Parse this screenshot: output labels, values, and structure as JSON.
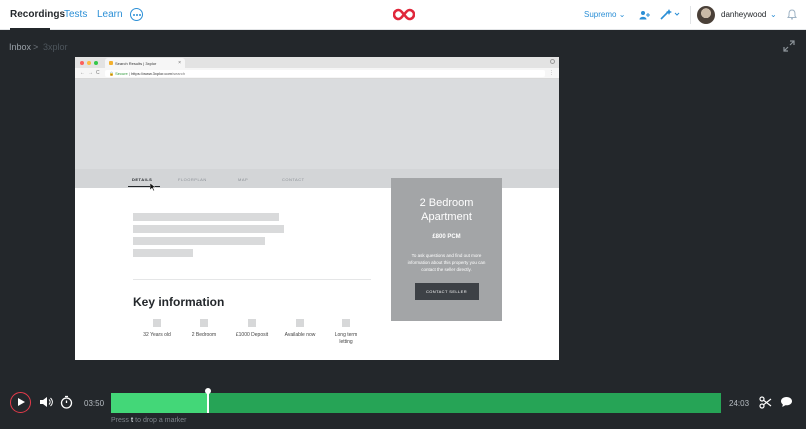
{
  "nav": {
    "recordings": "Recordings",
    "tests": "Tests",
    "learn": "Learn",
    "workspace": "Supremo",
    "username": "danheywood",
    "brand_color": "#e0273b"
  },
  "breadcrumb": {
    "inbox": "Inbox",
    "separator": ">",
    "current": "3xplor"
  },
  "video": {
    "browser": {
      "tab_title": "Search Results | 3xplor",
      "tab_close": "×",
      "url_secure": "Secure",
      "url_host": "https://www.3xplor.com",
      "url_path": "/search"
    },
    "page_tabs": [
      "DETAILS",
      "FLOORPLAN",
      "MAP",
      "CONTACT"
    ],
    "key_info_title": "Key information",
    "features": [
      "32 Years old",
      "2 Bedroom",
      "£1000 Deposit",
      "Available now",
      "Long term letting"
    ],
    "card": {
      "title": "2 Bedroom Apartment",
      "price": "£800 PCM",
      "text": "To ask questions and find out more information about this property you can contact the seller directly.",
      "button": "CONTACT SELLER"
    }
  },
  "player": {
    "current_time": "03:50",
    "total_time": "24:03",
    "progress": 0.159,
    "hint_prefix": "Press",
    "hint_key": "t",
    "hint_suffix": "to drop a marker"
  }
}
